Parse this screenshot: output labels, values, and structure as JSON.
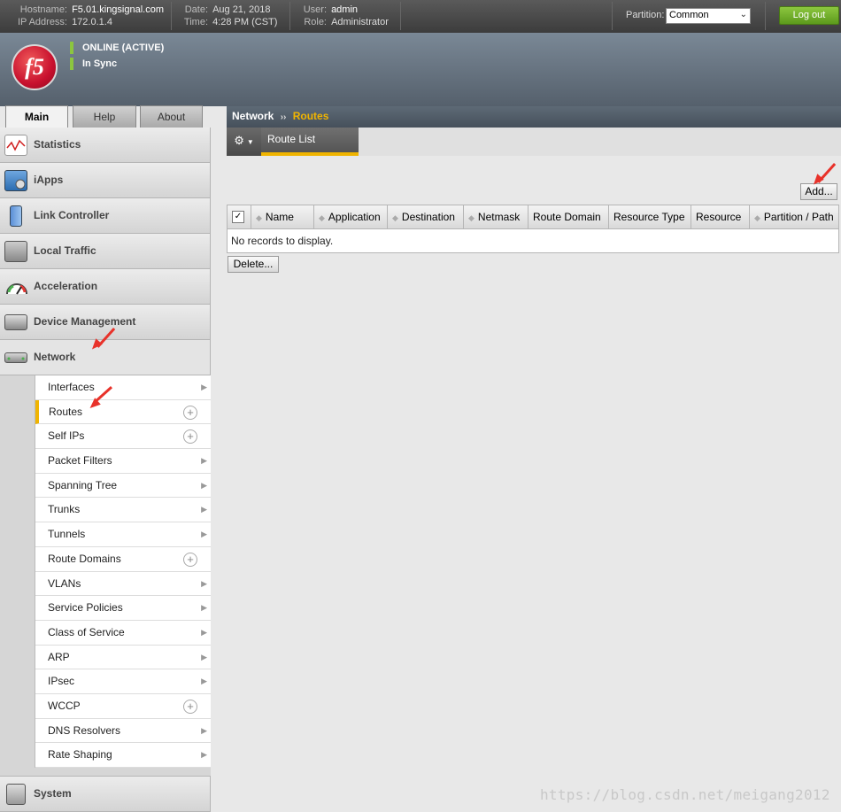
{
  "topbar": {
    "hostname_label": "Hostname:",
    "hostname": "F5.01.kingsignal.com",
    "ip_label": "IP Address:",
    "ip": "172.0.1.4",
    "date_label": "Date:",
    "date": "Aug 21, 2018",
    "time_label": "Time:",
    "time": "4:28 PM (CST)",
    "user_label": "User:",
    "user": "admin",
    "role_label": "Role:",
    "role": "Administrator",
    "partition_label": "Partition:",
    "partition_value": "Common",
    "logout_label": "Log out"
  },
  "header": {
    "logo_text": "f5",
    "status_online": "ONLINE (ACTIVE)",
    "status_sync": "In Sync",
    "status_color": "#8cc63f"
  },
  "tabs": [
    "Main",
    "Help",
    "About"
  ],
  "sidebar": {
    "items": [
      {
        "label": "Statistics",
        "icon": "statistics-icon"
      },
      {
        "label": "iApps",
        "icon": "iapps-icon"
      },
      {
        "label": "Link Controller",
        "icon": "link-controller-icon"
      },
      {
        "label": "Local Traffic",
        "icon": "local-traffic-icon"
      },
      {
        "label": "Acceleration",
        "icon": "acceleration-icon"
      },
      {
        "label": "Device Management",
        "icon": "device-management-icon"
      },
      {
        "label": "Network",
        "icon": "network-icon"
      }
    ],
    "network_submenu": [
      {
        "label": "Interfaces",
        "type": "arrow"
      },
      {
        "label": "Routes",
        "type": "plus"
      },
      {
        "label": "Self IPs",
        "type": "plus"
      },
      {
        "label": "Packet Filters",
        "type": "arrow"
      },
      {
        "label": "Spanning Tree",
        "type": "arrow"
      },
      {
        "label": "Trunks",
        "type": "arrow"
      },
      {
        "label": "Tunnels",
        "type": "arrow"
      },
      {
        "label": "Route Domains",
        "type": "plus"
      },
      {
        "label": "VLANs",
        "type": "arrow"
      },
      {
        "label": "Service Policies",
        "type": "arrow"
      },
      {
        "label": "Class of Service",
        "type": "arrow"
      },
      {
        "label": "ARP",
        "type": "arrow"
      },
      {
        "label": "IPsec",
        "type": "arrow"
      },
      {
        "label": "WCCP",
        "type": "plus"
      },
      {
        "label": "DNS Resolvers",
        "type": "arrow"
      },
      {
        "label": "Rate Shaping",
        "type": "arrow"
      }
    ],
    "system_label": "System"
  },
  "breadcrumb": {
    "parent": "Network",
    "separator": "››",
    "current": "Routes"
  },
  "subtab": {
    "label": "Route List"
  },
  "table": {
    "add_button": "Add...",
    "delete_button": "Delete...",
    "columns": [
      "Name",
      "Application",
      "Destination",
      "Netmask",
      "Route Domain",
      "Resource Type",
      "Resource",
      "Partition / Path"
    ],
    "empty_message": "No records to display."
  },
  "watermark": "https://blog.csdn.net/meigang2012",
  "accent_color": "#f0b400"
}
